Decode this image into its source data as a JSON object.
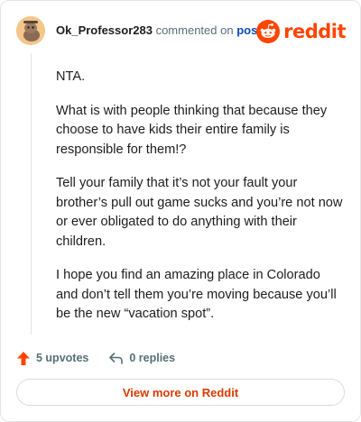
{
  "comment": {
    "username": "Ok_Professor283",
    "action_text": "commented on",
    "post_link": "post",
    "paragraphs": [
      "NTA.",
      "What is with people thinking that because they choose to have kids their entire family is responsible for them!?",
      "Tell your family that it’s not your fault your brother’s pull out game sucks and you’re not now or ever obligated to do anything with their children.",
      "I hope you find an amazing place in Colorado and don’t tell them you’re moving because you’ll be the new “vacation spot”."
    ]
  },
  "brand": {
    "logo_text": "reddit",
    "color": "#ff4500"
  },
  "actions": {
    "upvotes_label": "5 upvotes",
    "replies_label": "0 replies"
  },
  "footer": {
    "view_more_label": "View more on Reddit"
  }
}
